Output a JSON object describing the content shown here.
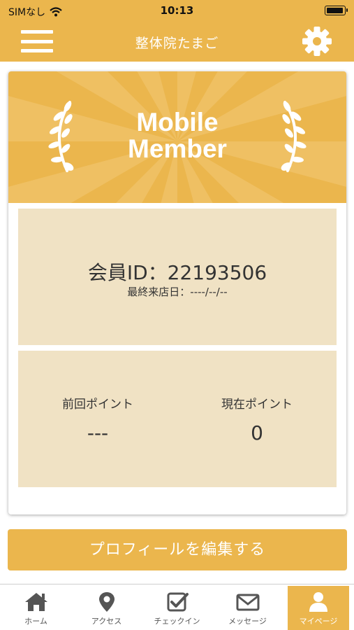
{
  "status_bar": {
    "carrier": "SIMなし",
    "time": "10:13",
    "battery_level": 0.9
  },
  "nav": {
    "title": "整体院たまご",
    "menu_icon": "hamburger-menu-icon",
    "settings_icon": "gear-icon"
  },
  "card": {
    "banner_title_line1": "Mobile",
    "banner_title_line2": "Member",
    "member_id": "会員ID：22193506",
    "last_visit": "最終来店日：----/--/--",
    "previous_points_label": "前回ポイント",
    "previous_points_value": "---",
    "current_points_label": "現在ポイント",
    "current_points_value": "0"
  },
  "edit_profile_label": "プロフィールを編集する",
  "tabs": [
    {
      "label": "ホーム",
      "icon": "home-icon"
    },
    {
      "label": "アクセス",
      "icon": "map-pin-icon"
    },
    {
      "label": "チェックイン",
      "icon": "checkbox-icon"
    },
    {
      "label": "メッセージ",
      "icon": "envelope-icon"
    },
    {
      "label": "マイページ",
      "icon": "user-icon",
      "active": true
    }
  ],
  "colors": {
    "accent": "#ebb64d",
    "panel": "#f0e2c4",
    "text": "#333333"
  }
}
